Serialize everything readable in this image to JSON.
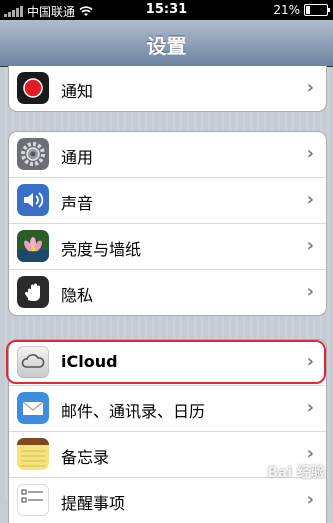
{
  "status_bar": {
    "carrier": "中国联通",
    "time": "15:31",
    "battery_text": "21%",
    "battery_level": 0.21,
    "wifi_icon": "wifi-icon"
  },
  "nav": {
    "title": "设置"
  },
  "groups": [
    {
      "rows": [
        {
          "label": "通知",
          "icon": "notification-icon"
        }
      ]
    },
    {
      "rows": [
        {
          "label": "通用",
          "icon": "gear-icon"
        },
        {
          "label": "声音",
          "icon": "speaker-icon"
        },
        {
          "label": "亮度与墙纸",
          "icon": "flower-icon"
        },
        {
          "label": "隐私",
          "icon": "hand-icon"
        }
      ]
    },
    {
      "rows": [
        {
          "label": "iCloud",
          "icon": "cloud-icon"
        },
        {
          "label": "邮件、通讯录、日历",
          "icon": "mail-icon"
        },
        {
          "label": "备忘录",
          "icon": "notes-icon"
        },
        {
          "label": "提醒事项",
          "icon": "reminders-icon"
        }
      ]
    }
  ],
  "watermark": "Bai 经验",
  "colors": {
    "highlight": "#e0283a",
    "nav_top": "#b1bccb",
    "nav_bottom": "#6d84a2"
  }
}
